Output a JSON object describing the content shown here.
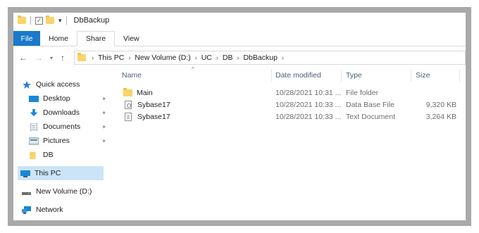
{
  "window": {
    "title": "DbBackup"
  },
  "ribbon": {
    "tabs": [
      "File",
      "Home",
      "Share",
      "View"
    ]
  },
  "address": {
    "crumbs": [
      "This PC",
      "New Volume (D:)",
      "UC",
      "DB",
      "DbBackup"
    ]
  },
  "nav": {
    "items": [
      {
        "label": "Quick access",
        "icon": "star-icon",
        "pinned": false
      },
      {
        "label": "Desktop",
        "icon": "desktop-icon",
        "pinned": true
      },
      {
        "label": "Downloads",
        "icon": "download-icon",
        "pinned": true
      },
      {
        "label": "Documents",
        "icon": "documents-icon",
        "pinned": true
      },
      {
        "label": "Pictures",
        "icon": "pictures-icon",
        "pinned": true
      },
      {
        "label": "DB",
        "icon": "folder-icon",
        "pinned": false
      },
      {
        "label": "This PC",
        "icon": "pc-icon",
        "pinned": false,
        "selected": true
      },
      {
        "label": "New Volume (D:)",
        "icon": "drive-icon",
        "pinned": false
      },
      {
        "label": "Network",
        "icon": "network-icon",
        "pinned": false
      }
    ]
  },
  "columns": {
    "name": "Name",
    "date": "Date modified",
    "type": "Type",
    "size": "Size"
  },
  "files": [
    {
      "name": "Main",
      "date": "10/28/2021 10:31 ...",
      "type": "File folder",
      "size": "",
      "icon": "folder-icon"
    },
    {
      "name": "Sybase17",
      "date": "10/28/2021 10:33 ...",
      "type": "Data Base File",
      "size": "9,320 KB",
      "icon": "database-file-icon"
    },
    {
      "name": "Sybase17",
      "date": "10/28/2021 10:33 ...",
      "type": "Text Document",
      "size": "3,264 KB",
      "icon": "text-file-icon"
    }
  ],
  "colors": {
    "file_tab": "#1979ca",
    "selection": "#cce4f7",
    "folder": "#f8d46a",
    "header_text": "#4c607a"
  }
}
